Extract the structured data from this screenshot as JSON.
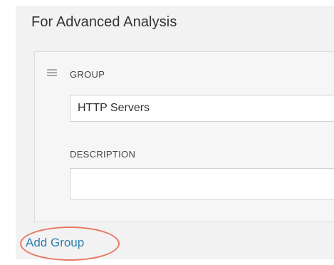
{
  "section": {
    "title": "For Advanced Analysis"
  },
  "group": {
    "handle_icon": "drag-handle-icon",
    "group_label": "GROUP",
    "group_value": "HTTP Servers",
    "description_label": "DESCRIPTION",
    "description_value": ""
  },
  "actions": {
    "add_group_label": "Add Group"
  },
  "colors": {
    "link": "#2e7fb0",
    "highlight": "#e8775e",
    "panel_bg": "#f2f2f2"
  }
}
